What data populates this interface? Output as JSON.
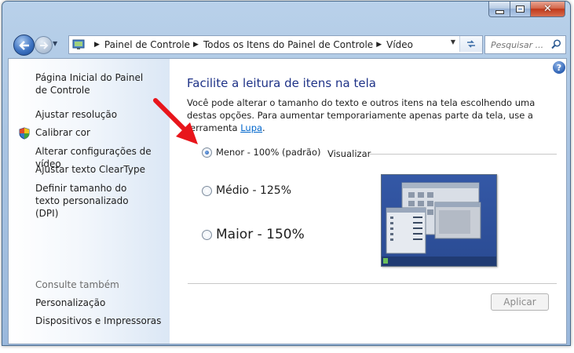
{
  "window": {
    "caption_buttons": {
      "minimize": "minimize-icon",
      "maximize": "maximize-icon",
      "close": "close-icon"
    }
  },
  "nav": {
    "breadcrumbs": [
      "Painel de Controle",
      "Todos os Itens do Painel de Controle",
      "Vídeo"
    ],
    "search_placeholder": "Pesquisar ..."
  },
  "sidebar": {
    "home_link": "Página Inicial do Painel de Controle",
    "links": [
      "Ajustar resolução",
      "Calibrar cor",
      "Alterar configurações de vídeo",
      "Ajustar texto ClearType",
      "Definir tamanho do texto personalizado (DPI)"
    ],
    "see_also_header": "Consulte também",
    "see_also": [
      "Personalização",
      "Dispositivos e Impressoras"
    ]
  },
  "main": {
    "help_label": "?",
    "title": "Facilite a leitura de itens na tela",
    "description_text": "Você pode alterar o tamanho do texto e outros itens na tela escolhendo uma destas opções. Para aumentar temporariamente apenas parte da tela, use a ferramenta ",
    "description_link": "Lupa",
    "description_end": ".",
    "options": [
      {
        "label": "Menor - 100% (padrão)",
        "checked": true
      },
      {
        "label": "Médio - 125%",
        "checked": false
      },
      {
        "label": "Maior - 150%",
        "checked": false
      }
    ],
    "preview_label": "Visualizar",
    "apply_label": "Aplicar"
  },
  "colors": {
    "title": "#1e3287",
    "link": "#0066cc",
    "annotation_arrow": "#e8151b"
  }
}
